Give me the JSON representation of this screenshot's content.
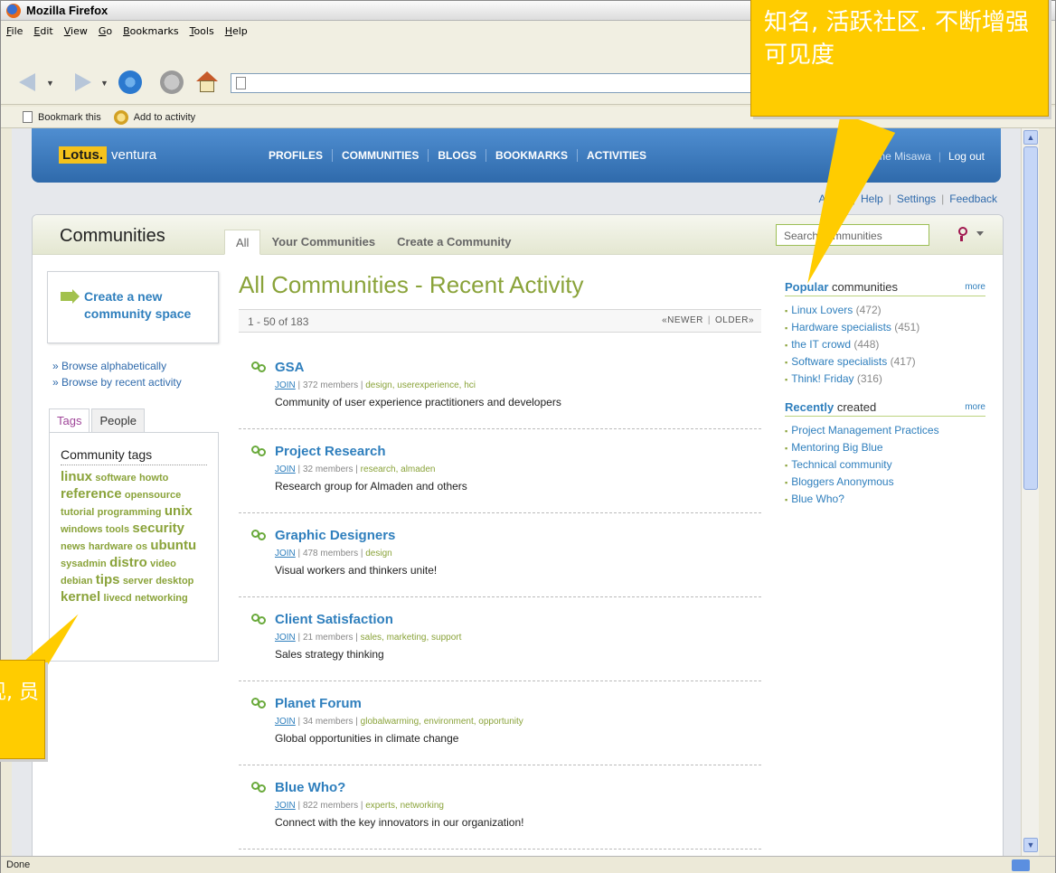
{
  "browser": {
    "window_title": "Mozilla Firefox",
    "menu": [
      "File",
      "Edit",
      "View",
      "Go",
      "Bookmarks",
      "Tools",
      "Help"
    ],
    "url": "",
    "bookmark_this": "Bookmark this",
    "add_to_activity": "Add to activity",
    "status": "Done"
  },
  "header": {
    "logo_lotus": "Lotus.",
    "logo_product": "ventura",
    "nav": [
      "PROFILES",
      "COMMUNITIES",
      "BLOGS",
      "BOOKMARKS",
      "ACTIVITIES"
    ],
    "welcome": "Welcome Misawa",
    "logout": "Log out"
  },
  "utility_links": [
    "About",
    "Help",
    "Settings",
    "Feedback"
  ],
  "panel": {
    "title": "Communities",
    "tabs": [
      "All",
      "Your Communities",
      "Create a Community"
    ],
    "search_placeholder": "Search communities"
  },
  "left": {
    "create_label": "Create a new community space",
    "browse_alpha": "» Browse alphabetically",
    "browse_recent": "» Browse by recent activity",
    "tag_tabs": [
      "Tags",
      "People"
    ],
    "tags_title": "Community tags",
    "tags": [
      {
        "t": "linux",
        "w": 3
      },
      {
        "t": "software",
        "w": 1
      },
      {
        "t": "howto",
        "w": 1
      },
      {
        "t": "reference",
        "w": 3
      },
      {
        "t": "opensource",
        "w": 1
      },
      {
        "t": "tutorial",
        "w": 1
      },
      {
        "t": "programming",
        "w": 1
      },
      {
        "t": "unix",
        "w": 3
      },
      {
        "t": "windows",
        "w": 1
      },
      {
        "t": "tools",
        "w": 1
      },
      {
        "t": "security",
        "w": 3
      },
      {
        "t": "news",
        "w": 1
      },
      {
        "t": "hardware",
        "w": 1
      },
      {
        "t": "os",
        "w": 1
      },
      {
        "t": "ubuntu",
        "w": 3
      },
      {
        "t": "sysadmin",
        "w": 1
      },
      {
        "t": "distro",
        "w": 3
      },
      {
        "t": "video",
        "w": 1
      },
      {
        "t": "debian",
        "w": 1
      },
      {
        "t": "tips",
        "w": 3
      },
      {
        "t": "server",
        "w": 1
      },
      {
        "t": "desktop",
        "w": 1
      },
      {
        "t": "kernel",
        "w": 3
      },
      {
        "t": "livecd",
        "w": 1
      },
      {
        "t": "networking",
        "w": 1
      }
    ]
  },
  "center": {
    "title": "All Communities - Recent Activity",
    "range": "1 - 50 of 183",
    "newer": "«NEWER",
    "older": "OLDER»",
    "communities": [
      {
        "name": "GSA",
        "join": "JOIN",
        "members": "372 members",
        "tags": "design, userexperience, hci",
        "desc": "Community of user experience practitioners and developers"
      },
      {
        "name": "Project Research",
        "join": "JOIN",
        "members": "32 members",
        "tags": "research, almaden",
        "desc": "Research group for Almaden and others"
      },
      {
        "name": "Graphic Designers",
        "join": "JOIN",
        "members": "478 members",
        "tags": "design",
        "desc": "Visual workers and thinkers unite!"
      },
      {
        "name": "Client Satisfaction",
        "join": "JOIN",
        "members": "21 members",
        "tags": "sales, marketing, support",
        "desc": "Sales strategy thinking"
      },
      {
        "name": "Planet Forum",
        "join": "JOIN",
        "members": "34 members",
        "tags": "globalwarming, environment, opportunity",
        "desc": "Global opportunities in climate change"
      },
      {
        "name": "Blue Who?",
        "join": "JOIN",
        "members": "822 members",
        "tags": "experts, networking",
        "desc": "Connect with the key innovators in our organization!"
      }
    ]
  },
  "right": {
    "popular_bold": "Popular",
    "popular_rest": " communities",
    "more": "more",
    "popular": [
      {
        "name": "Linux Lovers",
        "count": "(472)"
      },
      {
        "name": "Hardware specialists",
        "count": "(451)"
      },
      {
        "name": "the IT crowd",
        "count": "(448)"
      },
      {
        "name": "Software specialists",
        "count": "(417)"
      },
      {
        "name": "Think! Friday",
        "count": "(316)"
      }
    ],
    "recent_bold": "Recently",
    "recent_rest": " created",
    "recent": [
      "Project Management Practices",
      "Mentoring Big Blue",
      "Technical community",
      "Bloggers Anonymous",
      "Blue Who?"
    ]
  },
  "callouts": {
    "top": "知名, 活跃社区. 不断增强可见度",
    "left": "现, 员"
  }
}
